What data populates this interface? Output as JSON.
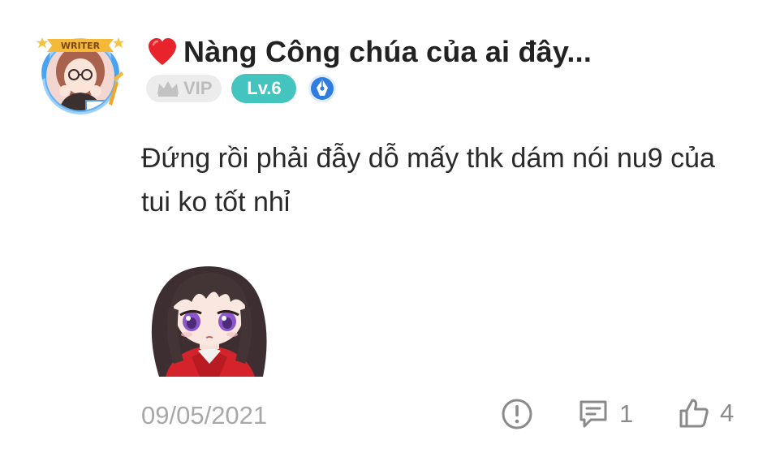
{
  "author": {
    "avatar_badge": "WRITER",
    "name": "Nàng Công chúa của ai đây...",
    "vip_label": "VIP",
    "level_label": "Lv.6",
    "heart_color": "#e8232c",
    "level_color": "#43c4bf",
    "writer_badge_color": "#2f7de1"
  },
  "comment": {
    "text": "Đứng rồi phải đẫy dỗ mấy thk dám nói nu9 của tui ko tốt nhỉ",
    "sticker": "anime-girl-sticker"
  },
  "footer": {
    "date": "09/05/2021",
    "report_icon": "exclamation-circle-icon",
    "reply_icon": "comment-icon",
    "reply_count": "1",
    "like_icon": "thumbs-up-icon",
    "like_count": "4"
  }
}
